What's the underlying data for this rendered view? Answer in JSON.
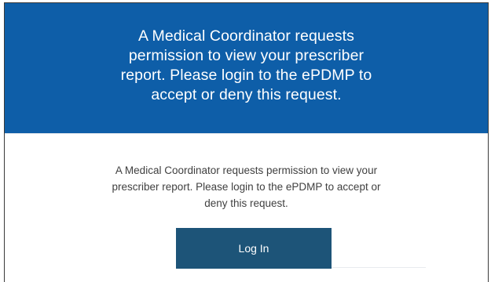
{
  "email": {
    "header_message": "A Medical Coordinator requests permission to view your prescriber report. Please login to the ePDMP to accept or deny this request.",
    "body_message": "A Medical Coordinator requests permission to view your prescriber report. Please login to the ePDMP to accept or deny this request.",
    "login_button_label": "Log In"
  },
  "colors": {
    "banner_background": "#0e5ea8",
    "button_background": "#1d5478",
    "body_text": "#404040"
  }
}
